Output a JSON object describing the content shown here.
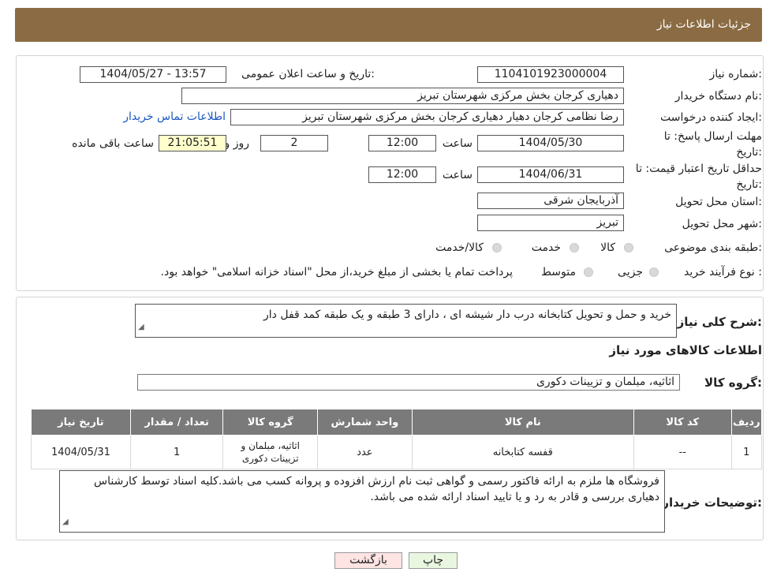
{
  "header": {
    "title": "جزئیات اطلاعات نیاز"
  },
  "form": {
    "need_number_label": "شماره نیاز:",
    "need_number": "1104101923000004",
    "announce_label": "تاریخ و ساعت اعلان عمومی:",
    "announce_value": "1404/05/27 - 13:57",
    "buyer_org_label": "نام دستگاه خریدار:",
    "buyer_org": "دهیاری کرجان بخش مرکزی شهرستان تبریز",
    "requester_label": "ایجاد کننده درخواست:",
    "requester": "رضا نظامی کرجان دهیار دهیاری کرجان بخش مرکزی شهرستان تبریز",
    "contact_link": "اطلاعات تماس خریدار",
    "deadline_label_1": "مهلت ارسال پاسخ: تا",
    "deadline_label_2": "تاریخ:",
    "deadline_date": "1404/05/30",
    "time_label": "ساعت",
    "deadline_time": "12:00",
    "days_value": "2",
    "days_label": "روز و",
    "remaining_time": "21:05:51",
    "remaining_label": "ساعت باقی مانده",
    "validity_label_1": "حداقل تاریخ اعتبار قیمت: تا",
    "validity_label_2": "تاریخ:",
    "validity_date": "1404/06/31",
    "validity_time_label": "ساعت",
    "validity_time": "12:00",
    "province_label": "استان محل تحویل:",
    "province": "آذربایجان شرقی",
    "city_label": "شهر محل تحویل:",
    "city": "تبریز",
    "category_label": "طبقه بندی موضوعی:",
    "category_options": [
      "کالا",
      "خدمت",
      "کالا/خدمت"
    ],
    "process_label": "نوع فرآیند خرید :",
    "process_options": [
      "جزیی",
      "متوسط"
    ],
    "process_note": "پرداخت تمام یا بخشی از مبلغ خرید،از محل \"اسناد خزانه اسلامی\" خواهد بود."
  },
  "description": {
    "label": "شرح کلی نیاز:",
    "value": "خرید و حمل و تحویل کتابخانه درب دار شیشه ای ، دارای 3 طبقه و یک طبقه کمد قفل دار"
  },
  "goods_info": {
    "title": "اطلاعات کالاهای مورد نیاز",
    "group_label": "گروه کالا:",
    "group_value": "اثاثیه، مبلمان و تزیینات دکوری"
  },
  "table": {
    "headers": [
      "ردیف",
      "کد کالا",
      "نام کالا",
      "واحد شمارش",
      "گروه کالا",
      "تعداد / مقدار",
      "تاریخ نیاز"
    ],
    "rows": [
      [
        "1",
        "--",
        "قفسه کتابخانه",
        "عدد",
        "اثاثیه، مبلمان و تزیینات دکوری",
        "1",
        "1404/05/31"
      ]
    ]
  },
  "buyer_notes": {
    "label": "توضیحات خریدار:",
    "value": "فروشگاه ها ملزم به ارائه فاکتور رسمی و گواهی ثبت نام ارزش افزوده و پروانه کسب می باشد.کلیه اسناد توسط کارشناس دهیاری بررسی و قادر به رد و یا تایید اسناد ارائه شده می باشد."
  },
  "buttons": {
    "print": "چاپ",
    "back": "بازگشت"
  },
  "colors": {
    "header_bg": "#8b6b43",
    "table_header_bg": "#7a7a7a",
    "back_btn_bg": "#ffe4e4",
    "print_btn_bg": "#e9f7e1"
  }
}
